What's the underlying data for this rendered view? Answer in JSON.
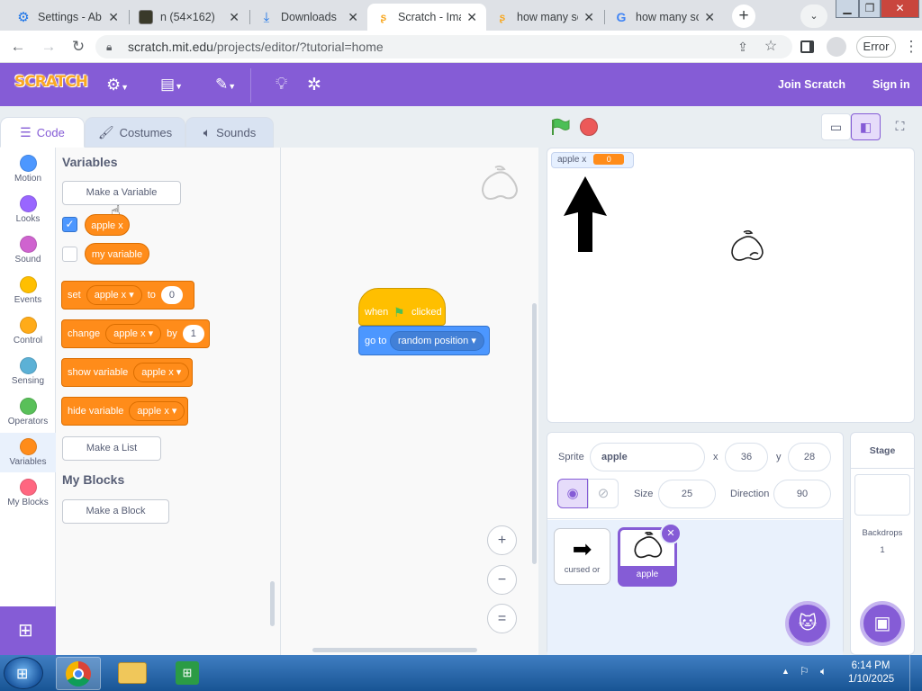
{
  "browser": {
    "tabs": [
      {
        "title": "Settings - Ab",
        "icon": "gear-icon",
        "active": false
      },
      {
        "title": "n (54×162)",
        "icon": "image-icon",
        "active": false
      },
      {
        "title": "Downloads",
        "icon": "download-icon",
        "active": false
      },
      {
        "title": "Scratch - Ima",
        "icon": "scratch-icon",
        "active": true
      },
      {
        "title": "how many sc",
        "icon": "scratch-icon",
        "active": false
      },
      {
        "title": "how many sc",
        "icon": "google-icon",
        "active": false
      }
    ],
    "url_host": "scratch.mit.edu",
    "url_path": "/projects/editor/?tutorial=home",
    "error_label": "Error"
  },
  "scratch": {
    "logo": "SCRATCH",
    "join": "Join Scratch",
    "signin": "Sign in",
    "tabs": {
      "code": "Code",
      "costumes": "Costumes",
      "sounds": "Sounds"
    },
    "categories": [
      {
        "label": "Motion",
        "color": "#4c97ff"
      },
      {
        "label": "Looks",
        "color": "#9966ff"
      },
      {
        "label": "Sound",
        "color": "#cf63cf"
      },
      {
        "label": "Events",
        "color": "#ffbf00"
      },
      {
        "label": "Control",
        "color": "#ffab19"
      },
      {
        "label": "Sensing",
        "color": "#5cb1d6"
      },
      {
        "label": "Operators",
        "color": "#59c059"
      },
      {
        "label": "Variables",
        "color": "#ff8c1a"
      },
      {
        "label": "My Blocks",
        "color": "#ff6680"
      }
    ],
    "palette": {
      "variables_title": "Variables",
      "make_variable": "Make a Variable",
      "var1": "apple x",
      "var2": "my variable",
      "set_word": "set",
      "set_var": "apple x",
      "set_to": "to",
      "set_val": "0",
      "change_word": "change",
      "change_var": "apple x",
      "change_by": "by",
      "change_val": "1",
      "show_word": "show variable",
      "show_var": "apple x",
      "hide_word": "hide variable",
      "hide_var": "apple x",
      "make_list": "Make a List",
      "myblocks_title": "My Blocks",
      "make_block": "Make a Block"
    },
    "script": {
      "when": "when",
      "clicked": "clicked",
      "goto": "go to",
      "goto_target": "random position"
    },
    "zoom": {
      "in": "+",
      "out": "−",
      "reset": "="
    },
    "stage": {
      "monitor_label": "apple x",
      "monitor_value": "0"
    },
    "sprite_info": {
      "sprite_label": "Sprite",
      "sprite_name": "apple",
      "x_label": "x",
      "x_value": "36",
      "y_label": "y",
      "y_value": "28",
      "size_label": "Size",
      "size_value": "25",
      "direction_label": "Direction",
      "direction_value": "90"
    },
    "sprites": [
      {
        "name": "cursed or",
        "selected": false
      },
      {
        "name": "apple",
        "selected": true
      }
    ],
    "stage_panel": {
      "title": "Stage",
      "backdrops_label": "Backdrops",
      "backdrops_count": "1"
    }
  },
  "taskbar": {
    "time": "6:14 PM",
    "date": "1/10/2025"
  }
}
